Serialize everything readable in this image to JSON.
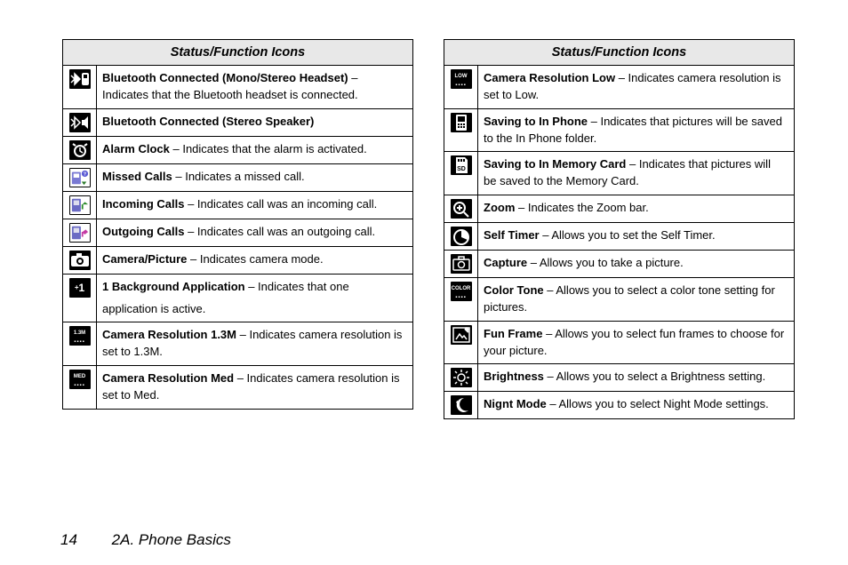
{
  "header": "Status/Function Icons",
  "footer": {
    "page_number": "14",
    "section": "2A. Phone Basics"
  },
  "left_column": [
    {
      "icon": "bluetooth-headset",
      "term": "Bluetooth Connected (Mono/Stereo Headset)",
      "desc": " – Indicates that the Bluetooth headset is connected."
    },
    {
      "icon": "bluetooth-speaker",
      "term": "Bluetooth Connected (Stereo Speaker)",
      "desc": ""
    },
    {
      "icon": "alarm-clock",
      "term": "Alarm Clock",
      "desc": " – Indicates that the alarm is activated."
    },
    {
      "icon": "missed-call",
      "term": "Missed Calls",
      "desc": " – Indicates a missed call."
    },
    {
      "icon": "incoming-call",
      "term": "Incoming Calls",
      "desc": " – Indicates call was an incoming call."
    },
    {
      "icon": "outgoing-call",
      "term": "Outgoing Calls",
      "desc": " – Indicates call was an outgoing call."
    },
    {
      "icon": "camera",
      "term": "Camera/Picture",
      "desc": " – Indicates camera mode."
    },
    {
      "icon": "background-app",
      "term": "1 Background Application",
      "desc": " – Indicates that one application is active."
    },
    {
      "icon": "res-13m",
      "term": "Camera Resolution 1.3M",
      "desc": " – Indicates camera resolution is set to 1.3M."
    },
    {
      "icon": "res-med",
      "term": "Camera Resolution Med",
      "desc": " – Indicates camera resolution is set to Med."
    }
  ],
  "right_column": [
    {
      "icon": "res-low",
      "term": "Camera Resolution Low",
      "desc": " – Indicates camera resolution is set to Low."
    },
    {
      "icon": "save-phone",
      "term": "Saving to In Phone",
      "desc": " – Indicates that pictures will be saved to the In Phone folder."
    },
    {
      "icon": "save-sd",
      "term": "Saving to In Memory Card",
      "desc": " – Indicates that pictures will be saved to the Memory Card."
    },
    {
      "icon": "zoom",
      "term": "Zoom",
      "desc": " – Indicates the Zoom bar."
    },
    {
      "icon": "self-timer",
      "term": "Self Timer",
      "desc": " – Allows you to set the Self Timer."
    },
    {
      "icon": "capture",
      "term": "Capture",
      "desc": " – Allows you to take a picture."
    },
    {
      "icon": "color-tone",
      "term": "Color Tone",
      "desc": " – Allows you to select a color tone setting for pictures."
    },
    {
      "icon": "fun-frame",
      "term": "Fun Frame",
      "desc": " – Allows you to select fun frames to choose for your picture."
    },
    {
      "icon": "brightness",
      "term": "Brightness",
      "desc": " – Allows you to select a Brightness setting."
    },
    {
      "icon": "night-mode",
      "term": "Nignt Mode",
      "desc": " – Allows you to select Night Mode settings."
    }
  ],
  "icon_labels": {
    "res-13m": "1.3M",
    "res-med": "MED",
    "res-low": "LOW",
    "background-app": "+1",
    "color-tone": "COLOR"
  }
}
